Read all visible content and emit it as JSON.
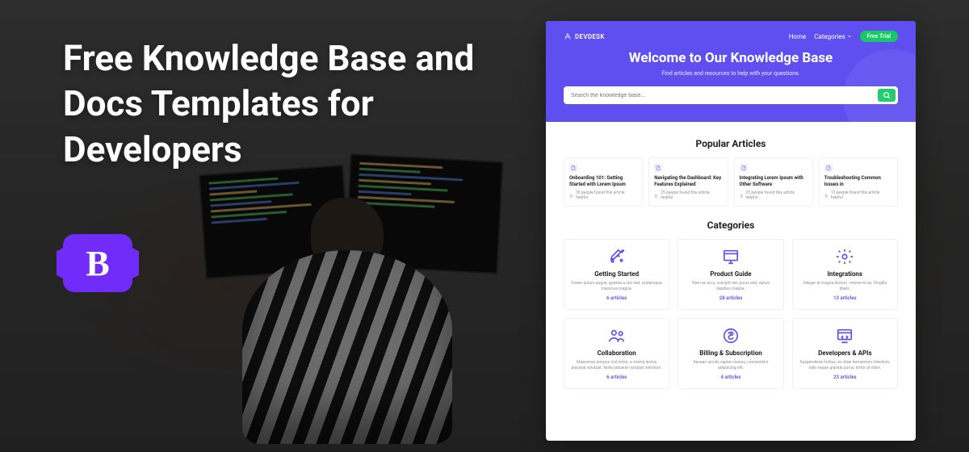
{
  "headline": "Free Knowledge Base and Docs Templates for Developers",
  "bootstrap_glyph": "B",
  "preview": {
    "brand": "DEVDESK",
    "nav": {
      "home": "Home",
      "categories": "Categories",
      "cta": "Free Trial"
    },
    "hero": {
      "title": "Welcome to Our Knowledge Base",
      "subtitle": "Find articles and resources to help with your questions.",
      "search_placeholder": "Search the knowledge base..."
    },
    "popular": {
      "heading": "Popular Articles",
      "items": [
        {
          "title": "Onboarding 101: Getting Started with Lorem Ipsum",
          "meta": "30 people found this article helpful"
        },
        {
          "title": "Navigating the Dashboard: Key Features Explained",
          "meta": "25 people found this article helpful"
        },
        {
          "title": "Integrating Lorem Ipsum with Other Software",
          "meta": "25 people found this article helpful"
        },
        {
          "title": "Troubleshooting Common Issues in",
          "meta": "13 people found this article helpful"
        }
      ]
    },
    "categories": {
      "heading": "Categories",
      "items": [
        {
          "title": "Getting Started",
          "desc": "Donec ipsum augue, gravida a nisl sed, scelerisque maximus magna.",
          "count": "6 articles"
        },
        {
          "title": "Product Guide",
          "desc": "Nam ex arcu, suscipit nec purus sed, varius dapibus magna.",
          "count": "28 articles"
        },
        {
          "title": "Integrations",
          "desc": "Integer at magna dictum, viverra mi ac, fringilla libero.",
          "count": "13 articles"
        },
        {
          "title": "Collaboration",
          "desc": "Maecenas tempus nisl tortor, a viverra lectus placerat volutpat. Nulla placerat volutpat interdum.",
          "count": "6 articles"
        },
        {
          "title": "Billing & Subscription",
          "desc": "Aenean iaculis sapien massa, consectetur adipiscing elit.",
          "count": "4 articles"
        },
        {
          "title": "Developers & APIs",
          "desc": "Suspendisse finibus, ex vitae fermentum interdum, odio neque gravida purus, tortor at diam.",
          "count": "23 articles"
        }
      ]
    }
  }
}
